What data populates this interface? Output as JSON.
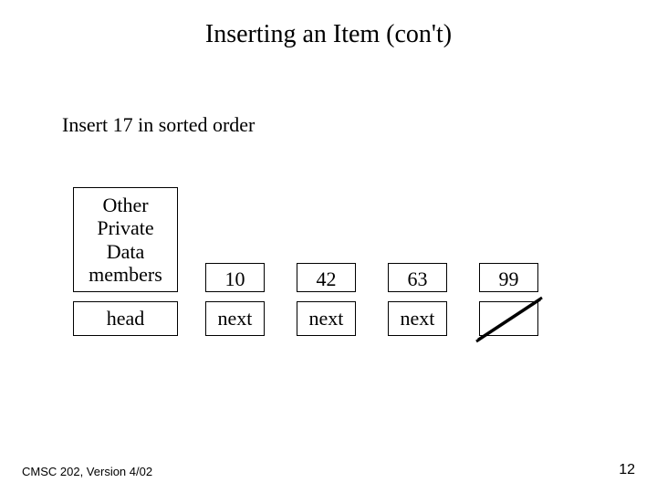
{
  "title": "Inserting an Item (con't)",
  "subtitle": "Insert 17 in sorted order",
  "labels": {
    "other_box": "Other\nPrivate\nData\nmembers",
    "head": "head",
    "next": "next"
  },
  "nodes": {
    "n1": "10",
    "n2": "42",
    "n3": "63",
    "n4": "99"
  },
  "footer": {
    "left": "CMSC 202, Version 4/02",
    "page": "12"
  }
}
